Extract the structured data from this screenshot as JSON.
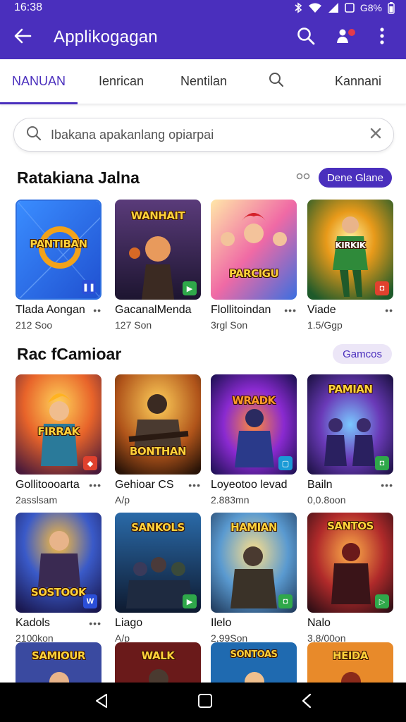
{
  "status": {
    "time": "16:38",
    "battery": "G8%"
  },
  "app_bar": {
    "title": "Applikogagan"
  },
  "tabs": [
    {
      "label": "NANUAN",
      "active": true
    },
    {
      "label": "Ienrican"
    },
    {
      "label": "Nentilan"
    },
    {
      "icon": "search-icon"
    },
    {
      "label": "Kannani"
    }
  ],
  "search": {
    "placeholder": "Ibakana apakanlang opiarpai"
  },
  "section1": {
    "title": "Ratakiana Jalna",
    "button": "Dene Glane",
    "cards": [
      {
        "name": "Tlada Aongan",
        "sub": "212 Soo",
        "art": "PANTIBAN",
        "badge_color": "#2b4fd8",
        "more": "••"
      },
      {
        "name": "GacanalMenda",
        "sub": "127 Son",
        "art": "WANHAIT",
        "badge_color": "#2fa84a",
        "more": ""
      },
      {
        "name": "Flollitoindan",
        "sub": "3rgl Son",
        "art": "PARCIGU",
        "badge_color": "",
        "more": "•••"
      },
      {
        "name": "Viade",
        "sub": "1.5/Ggp",
        "art": "KIRKIK",
        "badge_color": "#e0412e",
        "more": "••"
      }
    ]
  },
  "section2": {
    "title": "Rac fCamioar",
    "button": "Gamcos",
    "rows": [
      [
        {
          "name": "Gollitoooarta",
          "sub": "2asslsam",
          "art": "FIRRAK",
          "badge_color": "#e0412e",
          "more": "•••"
        },
        {
          "name": "Gehioar CS",
          "sub": "A/p",
          "art": "BONTHAN",
          "badge_color": "",
          "more": "•••"
        },
        {
          "name": "Loyeotoo levad",
          "sub": "2.883mn",
          "art": "WRADK",
          "badge_color": "#1a9ad6",
          "more": ""
        },
        {
          "name": "Bailn",
          "sub": "0,0.8oon",
          "art": "PAMIAN",
          "badge_color": "#2fa84a",
          "more": "•••"
        }
      ],
      [
        {
          "name": "Kadols",
          "sub": "2100kon",
          "art": "SOSTOOK",
          "badge_color": "#2b4fd8",
          "more": "•••"
        },
        {
          "name": "Liago",
          "sub": "A/p",
          "art": "SANKOLS",
          "badge_color": "#2fa84a",
          "more": ""
        },
        {
          "name": "Ilelo",
          "sub": "2,99Son",
          "art": "HAMIAN",
          "badge_color": "#2fa84a",
          "more": ""
        },
        {
          "name": "Nalo",
          "sub": "3,8/00on",
          "art": "SANTOS",
          "badge_color": "#2fa84a",
          "more": ""
        }
      ],
      [
        {
          "name": "",
          "sub": "",
          "art": "SAMIOUR",
          "badge_color": "",
          "more": ""
        },
        {
          "name": "",
          "sub": "",
          "art": "WALK",
          "badge_color": "",
          "more": ""
        },
        {
          "name": "",
          "sub": "",
          "art": "SONTOAS",
          "badge_color": "",
          "more": ""
        },
        {
          "name": "",
          "sub": "",
          "art": "HEIDA",
          "badge_color": "",
          "more": ""
        }
      ]
    ]
  },
  "colors": {
    "primary": "#4a2fbd",
    "tab_active": "#4a2fbd",
    "status_bg": "#4a2fbd"
  }
}
